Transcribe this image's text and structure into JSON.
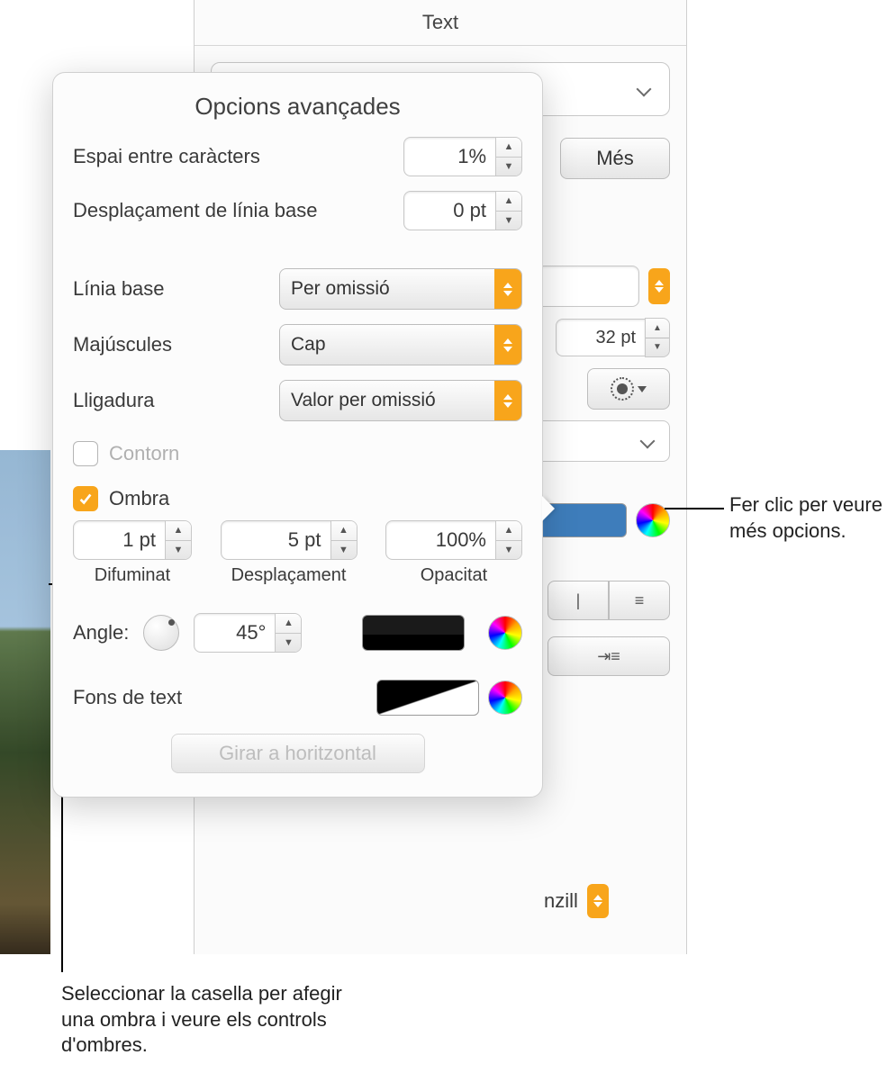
{
  "inspector": {
    "header": "Text",
    "mes_label": "Més",
    "font_size": "32 pt",
    "segmented_hint1": "|",
    "segmented_hint2": "≡",
    "indent_icon": "⇥≡",
    "senzill": "nzill"
  },
  "popover": {
    "title": "Opcions avançades",
    "char_spacing": {
      "label": "Espai entre caràcters",
      "value": "1%"
    },
    "baseline_shift": {
      "label": "Desplaçament de línia base",
      "value": "0 pt"
    },
    "line_base": {
      "label": "Línia base",
      "value": "Per omissió"
    },
    "caps": {
      "label": "Majúscules",
      "value": "Cap"
    },
    "ligature": {
      "label": "Lligadura",
      "value": "Valor per omissió"
    },
    "outline": {
      "label": "Contorn",
      "checked": false
    },
    "shadow": {
      "label": "Ombra",
      "checked": true,
      "blur": {
        "label": "Difuminat",
        "value": "1 pt"
      },
      "offset": {
        "label": "Desplaçament",
        "value": "5 pt"
      },
      "opacity": {
        "label": "Opacitat",
        "value": "100%"
      },
      "angle": {
        "label": "Angle:",
        "value": "45°"
      }
    },
    "text_bg": {
      "label": "Fons de text"
    },
    "rotate_btn": "Girar a horitzontal"
  },
  "callouts": {
    "right": "Fer clic per veure més opcions.",
    "bottom": "Seleccionar la casella per afegir una ombra i veure els controls d'ombres."
  }
}
